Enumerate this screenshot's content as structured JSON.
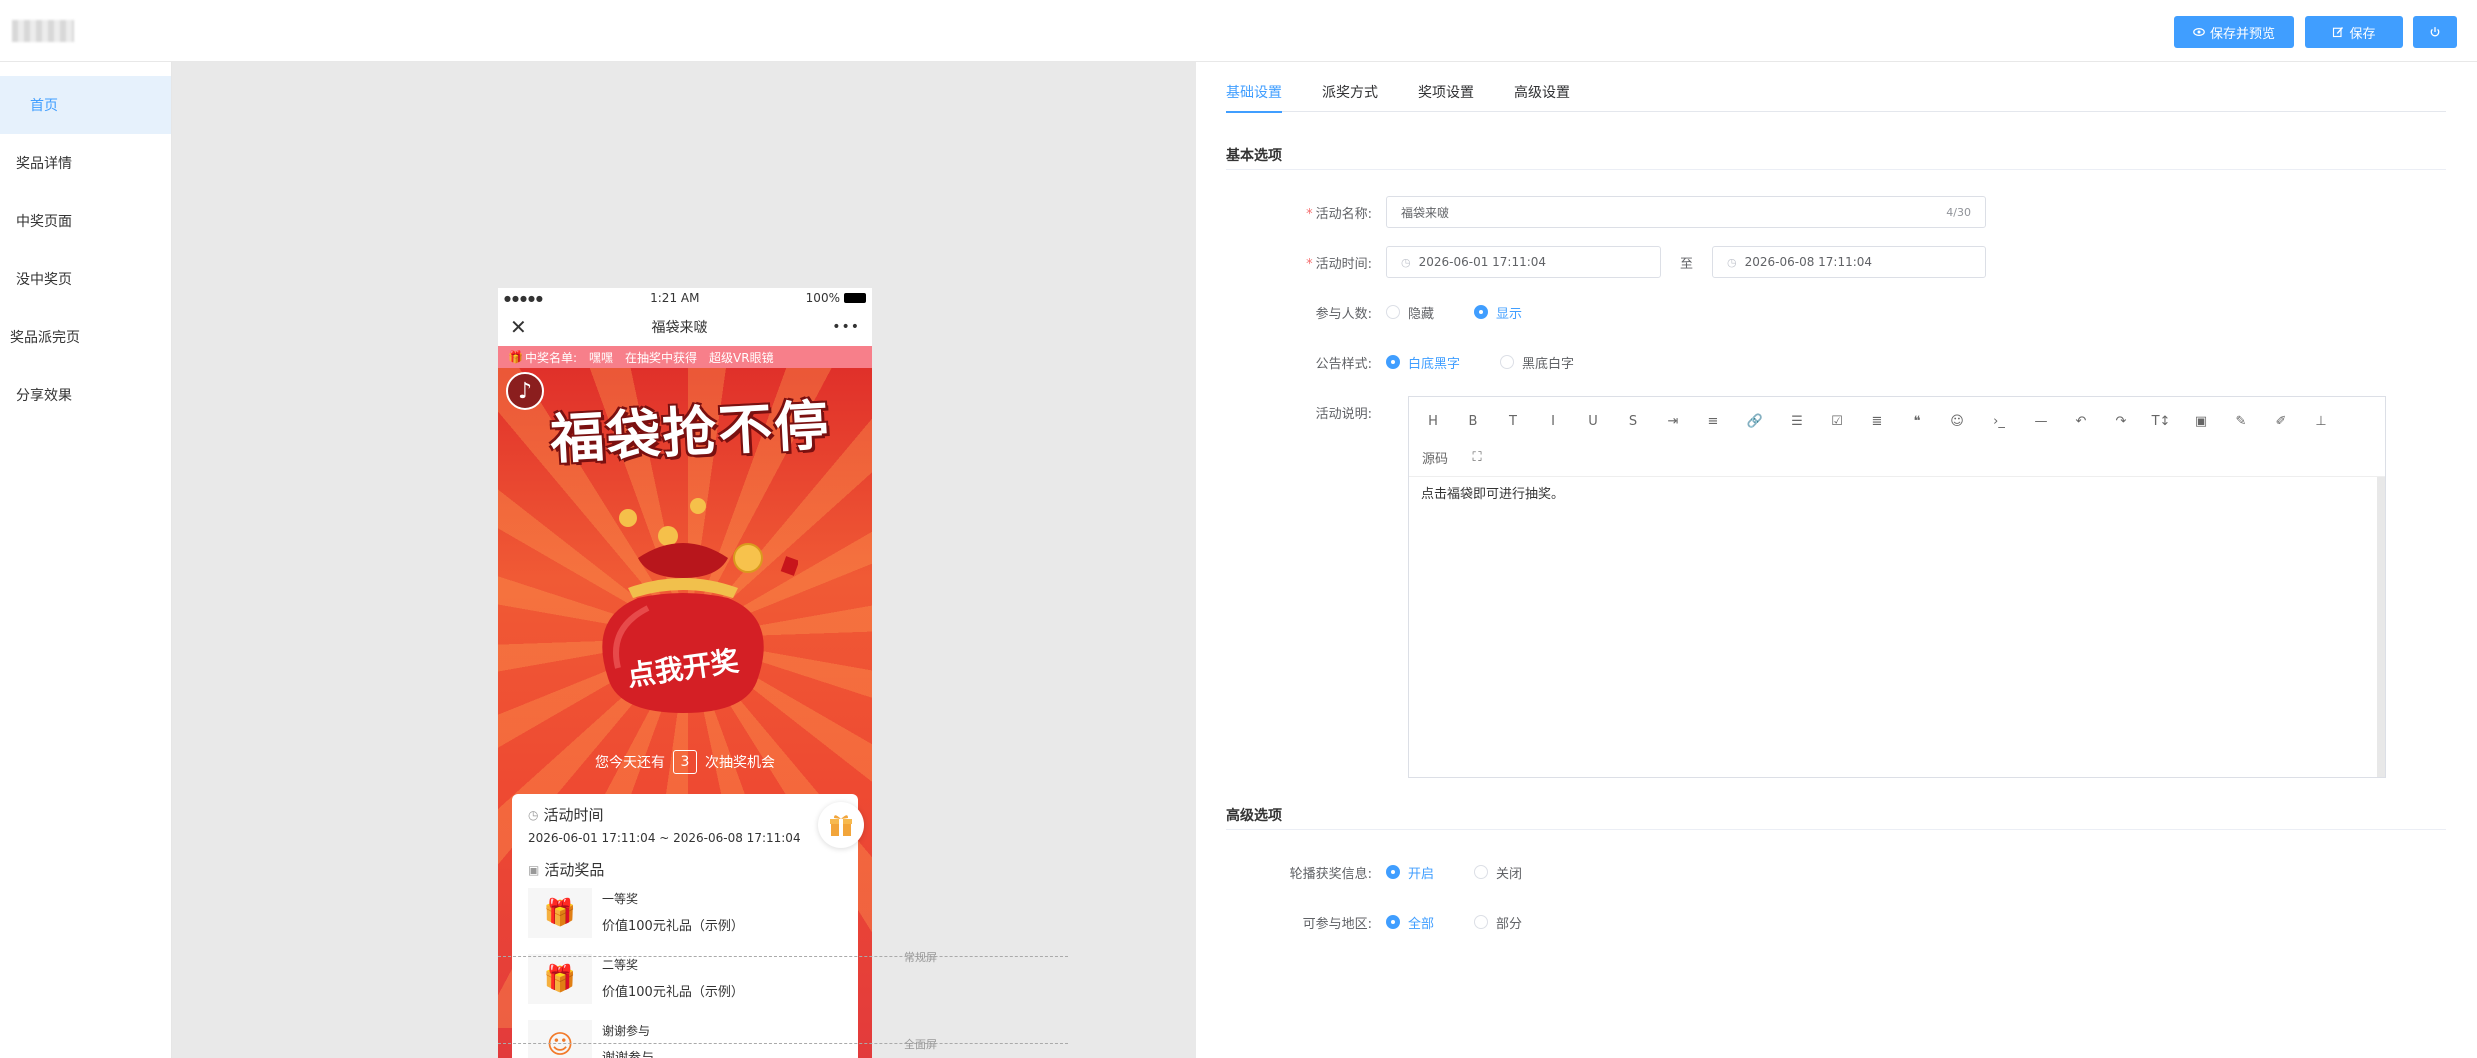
{
  "header": {
    "save_preview_label": "保存并预览",
    "save_label": "保存"
  },
  "sidebar": {
    "items": [
      {
        "label": "首页"
      },
      {
        "label": "奖品详情"
      },
      {
        "label": "中奖页面"
      },
      {
        "label": "没中奖页"
      },
      {
        "label": "奖品派完页"
      },
      {
        "label": "分享效果"
      }
    ]
  },
  "phone": {
    "status_left": "●●●●●",
    "status_time": "1:21 AM",
    "status_battery": "100%",
    "title": "福袋来啵",
    "more": "•••",
    "close": "✕",
    "marquee_label": "中奖名单:",
    "marquee_items": [
      "嘿嘿",
      "在抽奖中获得",
      "超级VR眼镜"
    ],
    "hero_title": "福袋抢不停",
    "bag_text": "点我开奖",
    "chance_prefix": "您今天还有",
    "chance_count": "3",
    "chance_suffix": "次抽奖机会",
    "time_title": "活动时间",
    "time_range": "2026-06-01 17:11:04 ~ 2026-06-08 17:11:04",
    "prize_title": "活动奖品",
    "prizes": [
      {
        "name": "一等奖",
        "desc": "价值100元礼品（示例）"
      },
      {
        "name": "二等奖",
        "desc": "价值100元礼品（示例）"
      },
      {
        "name": "谢谢参与",
        "desc": "谢谢参与"
      }
    ],
    "normal_screen_label": "常规屏",
    "full_screen_label": "全面屏"
  },
  "panel": {
    "tabs": [
      {
        "label": "基础设置"
      },
      {
        "label": "派奖方式"
      },
      {
        "label": "奖项设置"
      },
      {
        "label": "高级设置"
      }
    ],
    "basic_section": "基本选项",
    "name_label": "活动名称:",
    "name_value": "福袋来啵",
    "name_count": "4/30",
    "time_label": "活动时间:",
    "time_start": "2026-06-01 17:11:04",
    "time_to": "至",
    "time_end": "2026-06-08 17:11:04",
    "participants_label": "参与人数:",
    "participants_hide": "隐藏",
    "participants_show": "显示",
    "notice_label": "公告样式:",
    "notice_white": "白底黑字",
    "notice_black": "黑底白字",
    "desc_label": "活动说明:",
    "desc_text": "点击福袋即可进行抽奖。",
    "toolbar": [
      "H",
      "B",
      "T",
      "I",
      "U",
      "S",
      "⇥",
      "≡",
      "🔗",
      "☰",
      "☑",
      "≣",
      "❝",
      "☺",
      "›_",
      "—",
      "↶",
      "↷",
      "T↕",
      "▣",
      "✎",
      "✐",
      "⊥",
      "源码",
      "⛶"
    ],
    "advanced_section": "高级选项",
    "carousel_label": "轮播获奖信息:",
    "carousel_on": "开启",
    "carousel_off": "关闭",
    "region_label": "可参与地区:",
    "region_all": "全部",
    "region_part": "部分"
  },
  "colors": {
    "accent": "#409eff",
    "sidebar_active_bg": "#e6f1fc",
    "hero_red": "#e23a3c"
  }
}
